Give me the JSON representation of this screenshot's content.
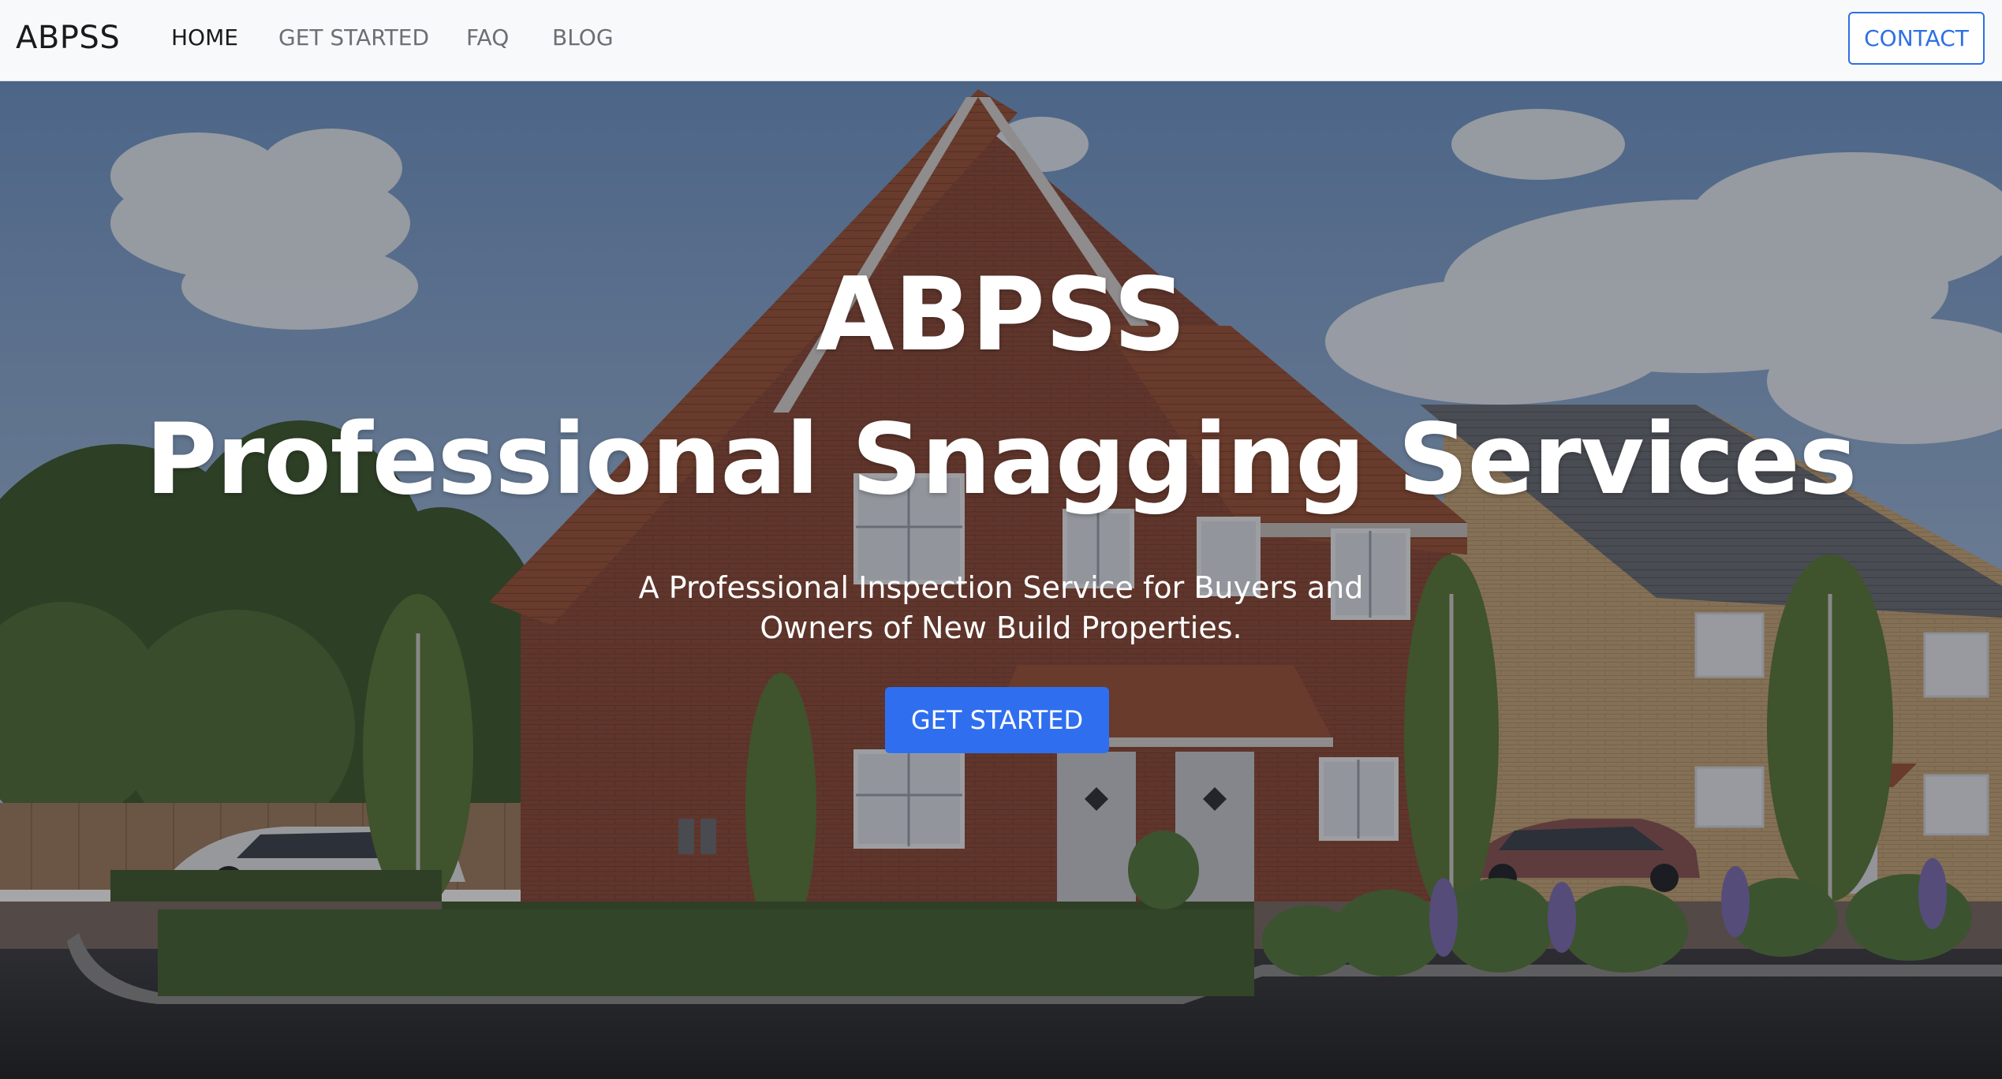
{
  "navbar": {
    "brand": "ABPSS",
    "links": [
      {
        "label": "HOME"
      },
      {
        "label": "GET STARTED"
      },
      {
        "label": "FAQ"
      },
      {
        "label": "BLOG"
      }
    ],
    "contact_label": "CONTACT"
  },
  "hero": {
    "title": "ABPSS",
    "subtitle": "Professional Snagging Services",
    "description": "A Professional Inspection Service for Buyers and Owners of New Build Properties.",
    "cta_label": "GET STARTED",
    "background_image": "house-photo"
  },
  "colors": {
    "accent": "#2f6fef",
    "navbar_bg": "#f8f9fa",
    "nav_text": "#6c6f73",
    "nav_active": "#1a1a1a"
  }
}
